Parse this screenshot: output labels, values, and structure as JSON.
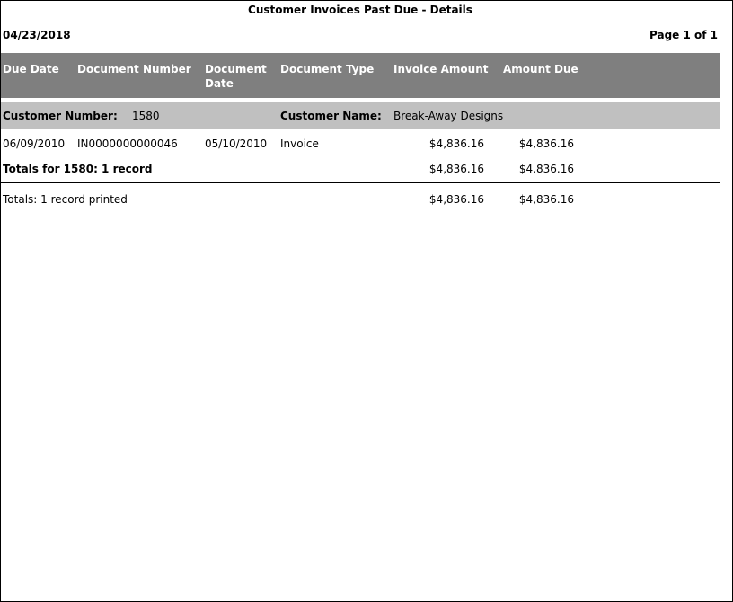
{
  "report": {
    "title": "Customer Invoices Past Due - Details",
    "date": "04/23/2018",
    "page": "Page 1 of 1"
  },
  "columns": {
    "due_date": "Due Date",
    "document_number": "Document Number",
    "document_date": "Document Date",
    "document_type": "Document Type",
    "invoice_amount": "Invoice Amount",
    "amount_due": "Amount Due"
  },
  "group": {
    "customer_number_label": "Customer Number:",
    "customer_number": "1580",
    "customer_name_label": "Customer Name:",
    "customer_name": "Break-Away Designs"
  },
  "rows": [
    {
      "due_date": "06/09/2010",
      "document_number": "IN0000000000046",
      "document_date": "05/10/2010",
      "document_type": "Invoice",
      "invoice_amount": "$4,836.16",
      "amount_due": "$4,836.16"
    }
  ],
  "group_totals": {
    "label": "Totals for 1580: 1 record",
    "invoice_amount": "$4,836.16",
    "amount_due": "$4,836.16"
  },
  "grand_totals": {
    "label": "Totals: 1 record printed",
    "invoice_amount": "$4,836.16",
    "amount_due": "$4,836.16"
  }
}
